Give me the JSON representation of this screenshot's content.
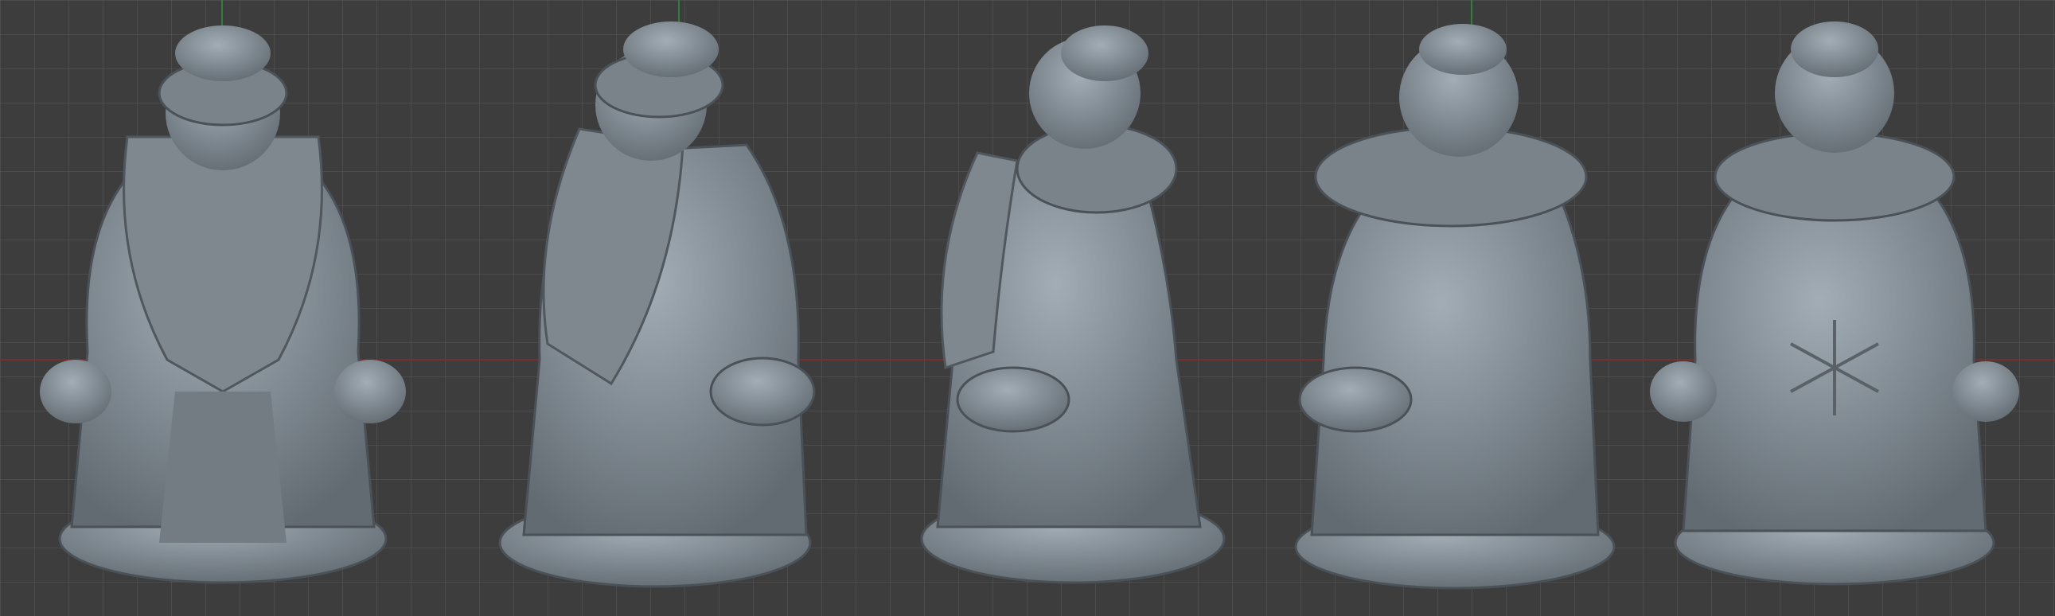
{
  "viewport": {
    "title": "",
    "background": "#3d3d3d",
    "grid_color": "#525252",
    "x_axis_color": "#8a2c2c",
    "y_axis_color": "#2f8a3a",
    "model_color": "#8a949c"
  },
  "models": [
    {
      "view": "front",
      "icon": "santa-figure-front"
    },
    {
      "view": "front-three-quarter",
      "icon": "santa-figure-three-quarter"
    },
    {
      "view": "side",
      "icon": "santa-figure-side"
    },
    {
      "view": "back-three-quarter",
      "icon": "santa-figure-back-three-quarter"
    },
    {
      "view": "back",
      "icon": "santa-figure-back"
    }
  ]
}
